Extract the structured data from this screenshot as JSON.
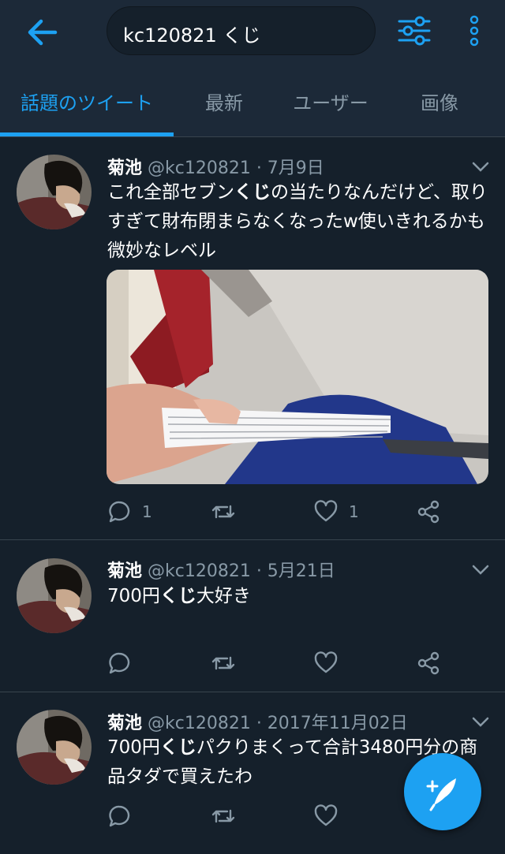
{
  "search": {
    "query": "kc120821 くじ"
  },
  "tabs": [
    "話題のツイート",
    "最新",
    "ユーザー",
    "画像"
  ],
  "tweets": [
    {
      "name": "菊池",
      "meta": " @kc120821 · 7月9日",
      "text_parts": [
        "これ全部セブン",
        "くじ",
        "の当たりなんだけど、取りすぎて財布閉まらなくなったw使いきれるかも微妙なレベル"
      ],
      "replies": "1",
      "likes": "1"
    },
    {
      "name": "菊池",
      "meta": " @kc120821 · 5月21日",
      "text_parts": [
        "700円",
        "くじ",
        "大好き"
      ]
    },
    {
      "name": "菊池",
      "meta": " @kc120821 · 2017年11月02日",
      "text_parts": [
        "700円",
        "くじ",
        "パクりまくって合計3480円分の商品タダで買えたわ"
      ]
    }
  ],
  "icons": {
    "back": "arrow-left-icon",
    "filter": "sliders-icon",
    "more": "vertical-dots-icon",
    "reply": "speech-bubble-icon",
    "retweet": "retweet-icon",
    "like": "heart-icon",
    "share": "share-icon",
    "compose": "compose-feather-icon"
  },
  "colors": {
    "accent": "#1da1f2",
    "background": "#15202b",
    "bar": "#1c2938",
    "muted": "#8899a6"
  }
}
